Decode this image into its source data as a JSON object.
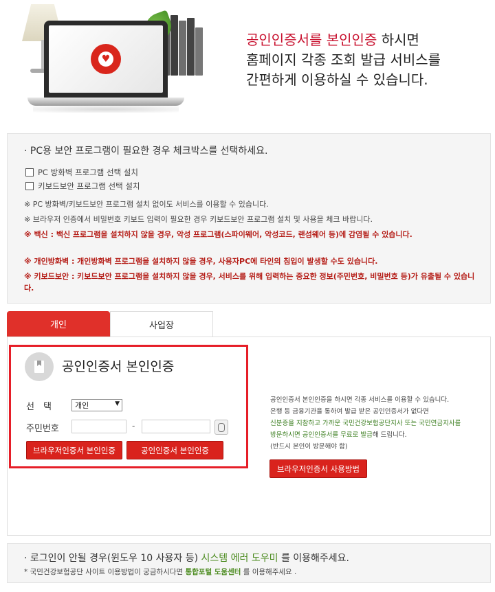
{
  "hero": {
    "highlight": "공인인증서를 본인인증",
    "line1_rest": " 하시면",
    "line2": "홈페이지 각종 조회 발급 서비스를",
    "line3": "간편하게 이용하실 수 있습니다."
  },
  "notice": {
    "heading": "· PC용 보안 프로그램이 필요한 경우 체크박스를 선택하세요.",
    "checkbox1": "PC 방화벽 프로그램 선택 설치",
    "checkbox2": "키보드보안 프로그램 선택 설치",
    "line1": "※ PC 방화벽/키보드보안 프로그램 설치 없이도 서비스를 이용할 수 있습니다.",
    "line2": "※ 브라우저 인증에서 비밀번호 키보드 입력이 필요한 경우 키보드보안 프로그램 설치 및 사용을 체크 바랍니다.",
    "red1": "※ 백신 : 백신 프로그램을 설치하지 않을 경우, 악성 프로그램(스파이웨어, 악성코드, 랜섬웨어 등)에 감염될 수 있습니다.",
    "red2": "※ 개인방화벽 : 개인방화벽 프로그램을 설치하지 않을 경우, 사용자PC에 타인의 침입이 발생할 수도 있습니다.",
    "red3": "※ 키보드보안 : 키보드보안 프로그램을 설치하지 않을 경우, 서비스를 위해 입력하는 중요한 정보(주민번호, 비밀번호 등)가 유출될 수 있습니다."
  },
  "tabs": {
    "personal": "개인",
    "business": "사업장"
  },
  "auth": {
    "title": "공인인증서 본인인증",
    "select_label": "선　택",
    "select_value": "개인",
    "rrn_label": "주민번호",
    "dash": "-",
    "btn_browser": "브라우저인증서 본인인증",
    "btn_cert": "공인인증서 본인인증"
  },
  "side": {
    "line1": "공인인증서 본인인증을 하시면 각종 서비스를 이용할 수 있습니다.",
    "line2": "은행 등 금융기관을 통하여 발급 받은 공인인증서가 없다면",
    "green1": "신분증을 지참하고 가까운 국민건강보험공단지사 또는 국민연금지사를",
    "green2a": "방문하시면 공인인증서를 무료로 발급",
    "line3_rest": "해 드립니다.",
    "line4": "(반드시 본인이 방문해야 함)",
    "button": "브라우저인증서 사용방법"
  },
  "bottom": {
    "b1_pre": "· 로그인이 안될 경우(윈도우 10 사용자 등) ",
    "b1_green": "시스템 에러 도우미",
    "b1_post": " 를 이용해주세요.",
    "b2_pre": "* 국민건강보험공단 사이트 이용방법이 궁금하시다면 ",
    "b2_green": "통합포털 도움센터",
    "b2_post": " 를 이용해주세요 ."
  }
}
